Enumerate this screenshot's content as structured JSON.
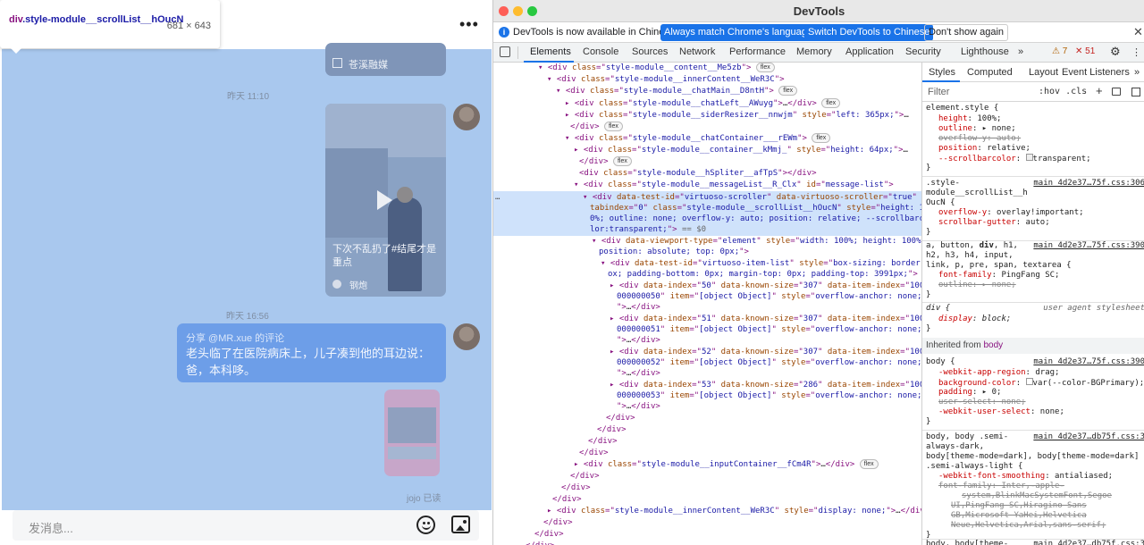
{
  "chat": {
    "tooltip": {
      "tag": "div",
      "class": ".style-module__scrollList__hOucN",
      "size": "681 × 643"
    },
    "more_icon": "•••",
    "top_card_caption": "苍溪融媒",
    "time1": "昨天 11:10",
    "video_caption": "下次不乱扔了#结尾才是重点",
    "video_author": "钢炮",
    "time2": "昨天 16:56",
    "share_line1": "分享 @MR.xue 的评论",
    "share_line2": "老头临了在医院病床上，儿子凑到他的耳边说：爸，本科哆。",
    "read_status": "jojo 已读",
    "input_placeholder": "发消息..."
  },
  "devtools": {
    "window_title": "DevTools",
    "infobar": {
      "message": "DevTools is now available in Chinese!",
      "btn_match": "Always match Chrome's language",
      "btn_switch": "Switch DevTools to Chinese",
      "btn_dont": "Don't show again"
    },
    "tabs": [
      "Elements",
      "Console",
      "Sources",
      "Network",
      "Performance",
      "Memory",
      "Application",
      "Security",
      "Lighthouse"
    ],
    "warnings": "7",
    "errors": "51",
    "style_tabs": [
      "Styles",
      "Computed",
      "Layout",
      "Event Listeners"
    ],
    "filter_placeholder": "Filter",
    "hov_cls": ":hov  .cls",
    "inherited_label": "Inherited from",
    "inherited_tag": "body"
  }
}
